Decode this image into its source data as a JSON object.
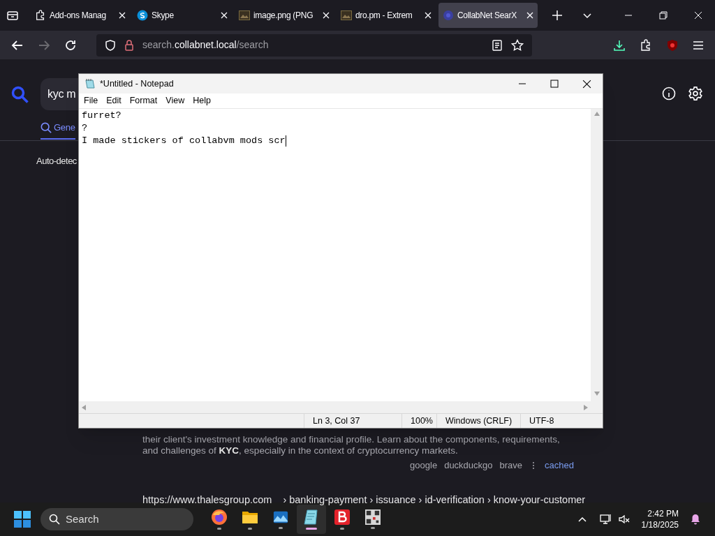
{
  "browser": {
    "tabs": [
      {
        "label": "Add-ons Manag",
        "kind": "puzzle",
        "selected": false
      },
      {
        "label": "Skype",
        "kind": "skype",
        "selected": false
      },
      {
        "label": "image.png (PNG",
        "kind": "image",
        "selected": false
      },
      {
        "label": "dro.pm - Extrem",
        "kind": "image",
        "selected": false
      },
      {
        "label": "CollabNet SearX",
        "kind": "globe",
        "selected": true
      }
    ],
    "address": {
      "prefix": "search.",
      "domain": "collabnet.local",
      "path": "/search"
    }
  },
  "page": {
    "query": "kyc m",
    "categories": [
      {
        "label": "Gene",
        "selected": true
      }
    ],
    "language": "Auto-detec",
    "result": {
      "snippet": "their client's investment knowledge and financial profile. Learn about the components, requirements, and challenges of **KYC**, especially in the context of cryptocurrency markets.",
      "engines": [
        "google",
        "duckduckgo",
        "brave"
      ],
      "cached": "cached"
    },
    "next_result": {
      "url": "https://www.thalesgroup.com",
      "path": "› banking-payment › issuance › id-verification › know-your-customer"
    }
  },
  "notepad": {
    "title": "*Untitled - Notepad",
    "menu": [
      "File",
      "Edit",
      "Format",
      "View",
      "Help"
    ],
    "lines": [
      "furret?",
      "?",
      "I made stickers of collabvm mods scr"
    ],
    "status": [
      "Ln 3, Col 37",
      "100%",
      "Windows (CRLF)",
      "UTF-8"
    ]
  },
  "taskbar": {
    "search_placeholder": "Search",
    "apps": [
      {
        "kind": "firefox",
        "active": false
      },
      {
        "kind": "folder",
        "active": false
      },
      {
        "kind": "photos",
        "active": false
      },
      {
        "kind": "notepad",
        "active": true
      },
      {
        "kind": "b",
        "active": false
      },
      {
        "kind": "qr",
        "active": false
      }
    ],
    "time": "2:42 PM",
    "date": "1/18/2025"
  }
}
